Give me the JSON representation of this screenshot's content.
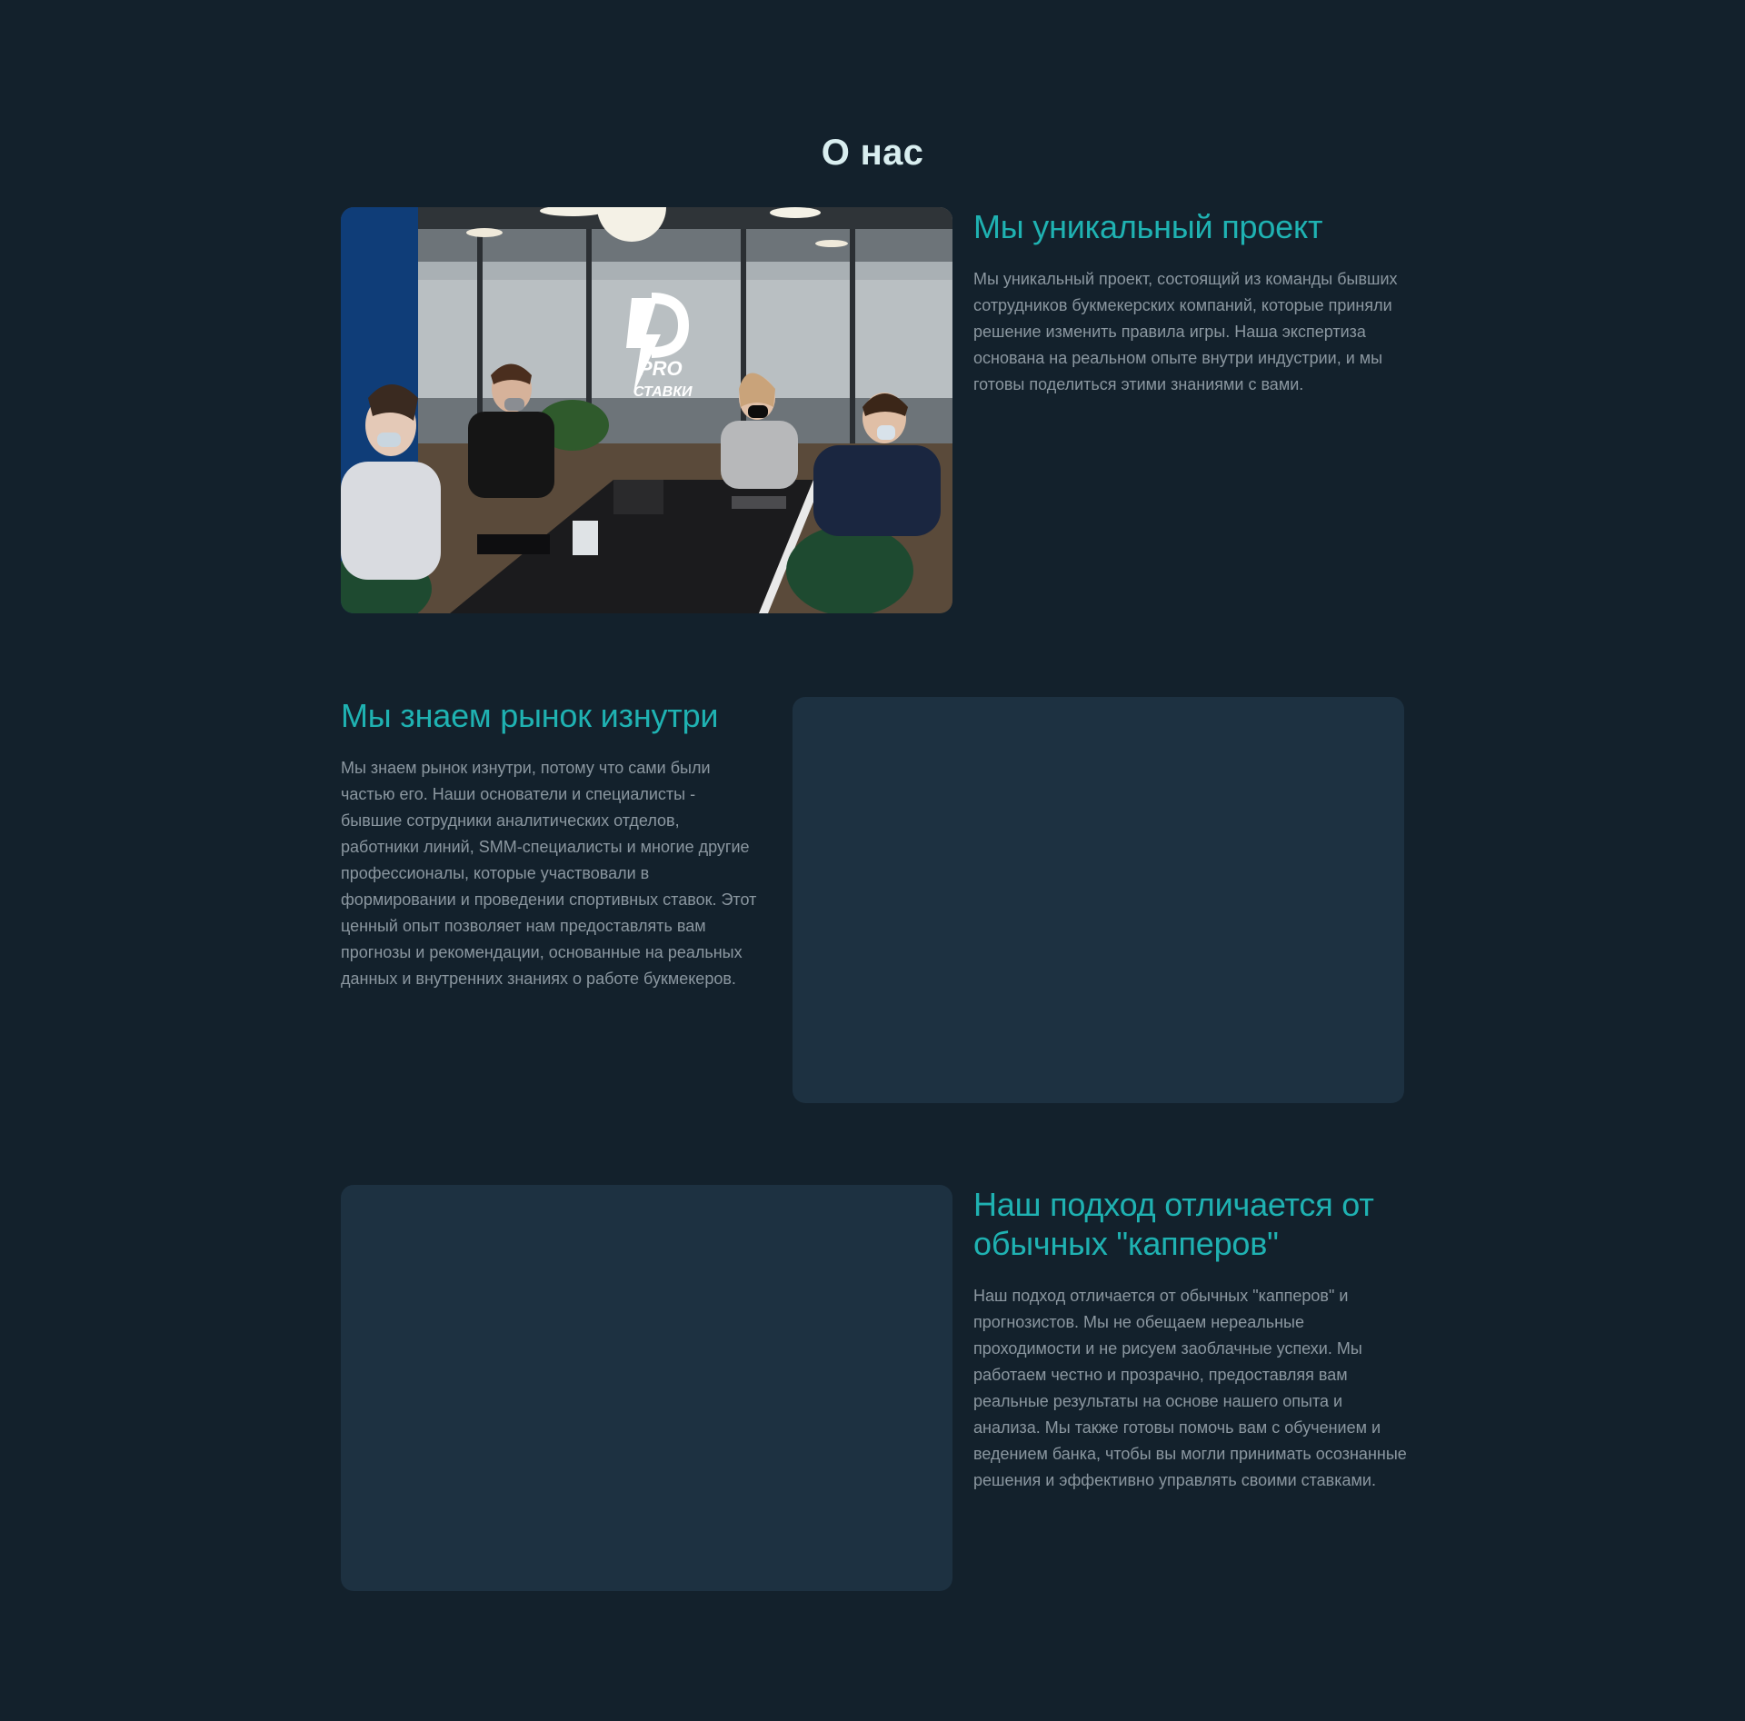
{
  "section": {
    "title": "О нас"
  },
  "blocks": [
    {
      "heading": "Мы уникальный проект",
      "text": "Мы уникальный проект, состоящий из команды бывших сотрудников букмекерских компаний, которые приняли решение изменить правила игры. Наша экспертиза основана на реальном опыте внутри индустрии, и мы готовы поделиться этими знаниями с вами."
    },
    {
      "heading": "Мы знаем рынок изнутри",
      "text": "Мы знаем рынок изнутри, потому что сами были частью его. Наши основатели и специалисты - бывшие сотрудники аналитических отделов, работники линий, SMM-специалисты и многие другие профессионалы, которые участвовали в формировании и проведении спортивных ставок. Этот ценный опыт позволяет нам предоставлять вам прогнозы и рекомендации, основанные на реальных данных и внутренних знаниях о работе букмекеров."
    },
    {
      "heading": "Наш подход отличается от обычных \"капперов\"",
      "text": "Наш подход отличается от обычных \"капперов\" и прогнозистов. Мы не обещаем нереальные проходимости и не рисуем заоблачные успехи. Мы работаем честно и прозрачно, предоставляя вам реальные результаты на основе нашего опыта и анализа. Мы также готовы помочь вам с обучением и ведением банка, чтобы вы могли принимать осознанные решения и эффективно управлять своими ставками."
    }
  ],
  "photo": {
    "logo_line1": "PRO",
    "logo_line2": "СТАВКИ"
  },
  "colors": {
    "background": "#13212c",
    "accent": "#1fb2b2",
    "title": "#d9eef0",
    "body_text": "#8b97a0",
    "placeholder": "#1d3141"
  }
}
